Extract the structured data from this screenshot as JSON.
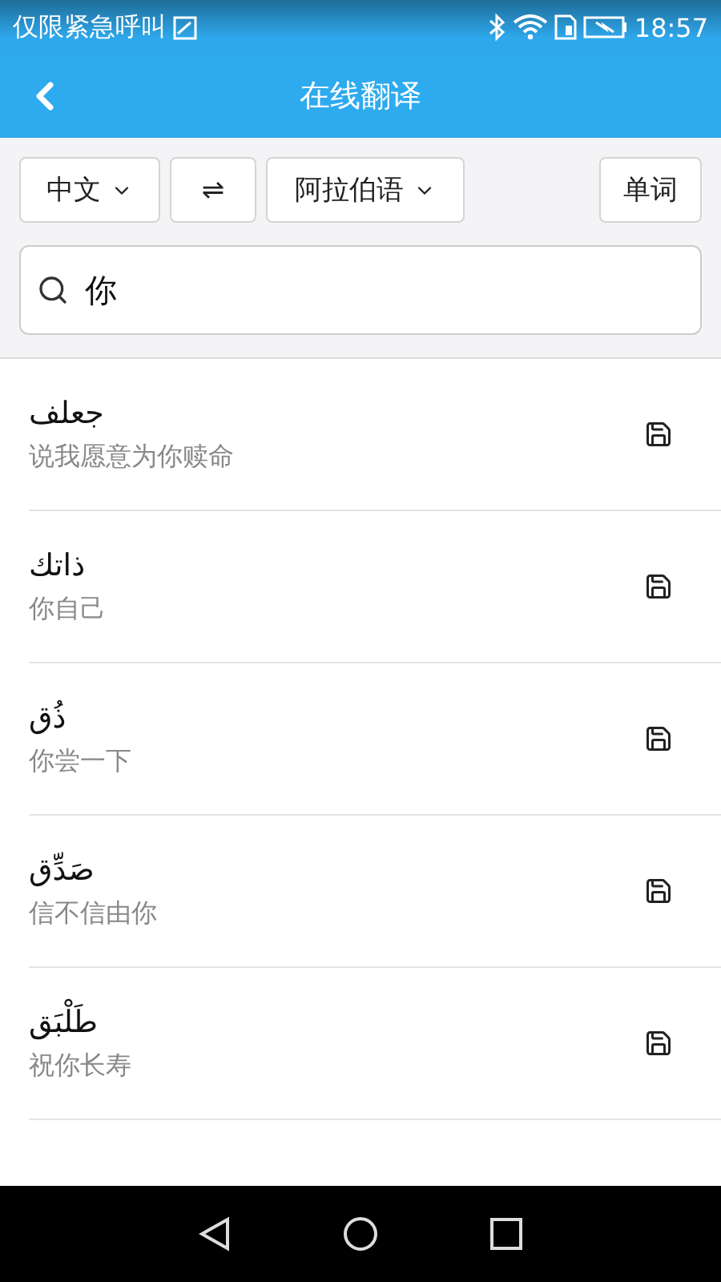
{
  "status_bar": {
    "carrier": "仅限紧急呼叫",
    "time": "18:57"
  },
  "header": {
    "title": "在线翻译"
  },
  "toolbar": {
    "source_language": "中文",
    "swap": "⇌",
    "target_language": "阿拉伯语",
    "mode": "单词"
  },
  "search": {
    "value": "你"
  },
  "results": [
    {
      "arabic": "جعلف",
      "chinese": "说我愿意为你赎命"
    },
    {
      "arabic": "ذاتك",
      "chinese": "你自己"
    },
    {
      "arabic": "ذُق",
      "chinese": "你尝一下"
    },
    {
      "arabic": "صَدِّق",
      "chinese": "信不信由你"
    },
    {
      "arabic": "طَلْبَق",
      "chinese": "祝你长寿"
    }
  ]
}
